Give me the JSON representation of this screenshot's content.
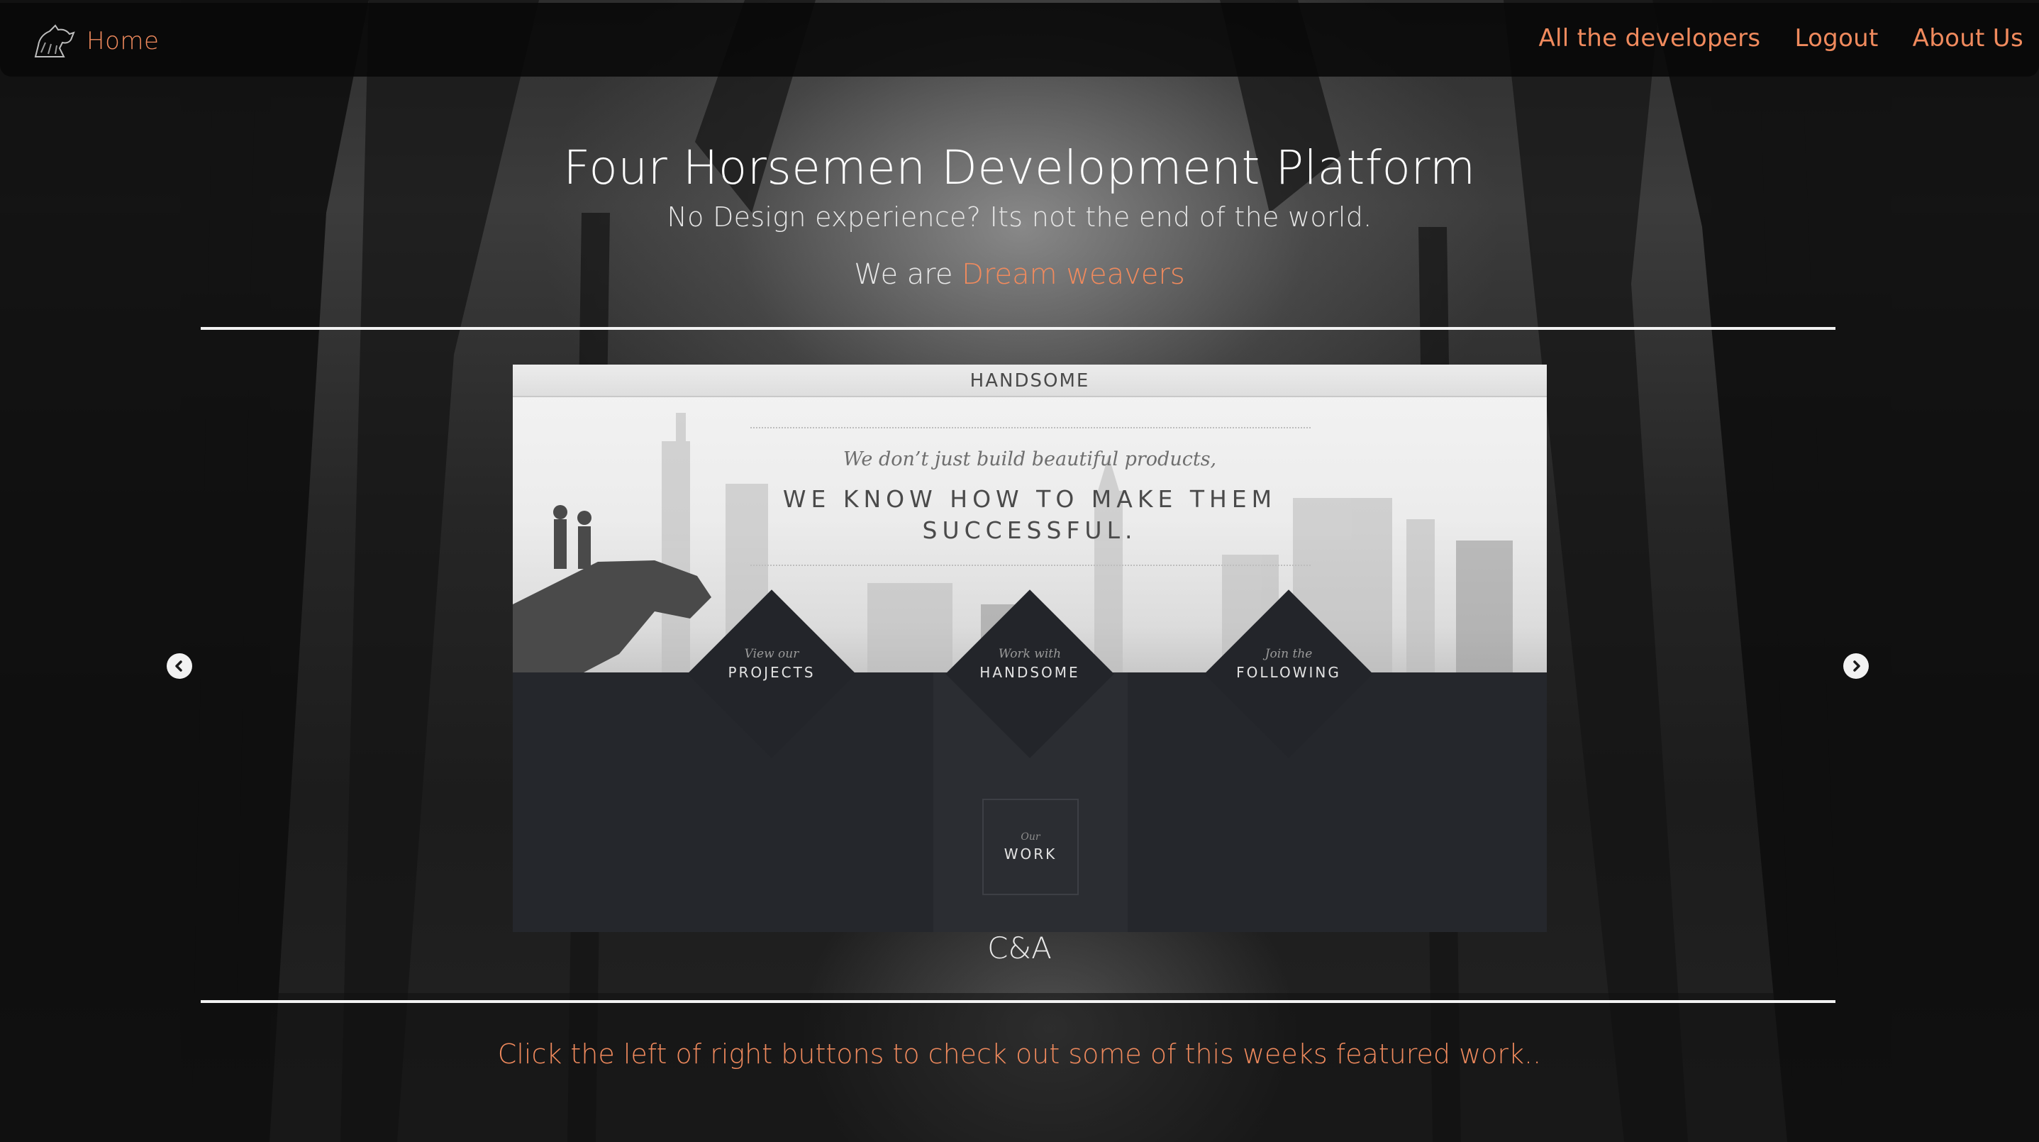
{
  "navbar": {
    "home_label": "Home",
    "links": [
      "All the developers",
      "Logout",
      "About Us"
    ]
  },
  "hero": {
    "title": "Four Horsemen Development Platform",
    "subtitle": "No Design experience? Its not the end of the world.",
    "tag_prefix": "We are ",
    "tag_accent": "Dream weavers"
  },
  "carousel": {
    "slide": {
      "header": "HANDSOME",
      "script_line": "We don’t just build beautiful products,",
      "headline_1": "WE KNOW HOW TO MAKE THEM",
      "headline_2": "SUCCESSFUL.",
      "diamonds": [
        {
          "small": "View our",
          "big": "PROJECTS"
        },
        {
          "small": "Work with",
          "big": "HANDSOME"
        },
        {
          "small": "Join the",
          "big": "FOLLOWING"
        }
      ],
      "work_small": "Our",
      "work_big": "WORK"
    },
    "caption": "C&A",
    "prev_icon": "chevron-left-icon",
    "next_icon": "chevron-right-icon"
  },
  "footer_note": "Click the left of right buttons to check out some of this weeks featured work..",
  "colors": {
    "accent": "#f08a5d",
    "navbar_bg": "#080808",
    "slide_dark": "#25272c"
  }
}
